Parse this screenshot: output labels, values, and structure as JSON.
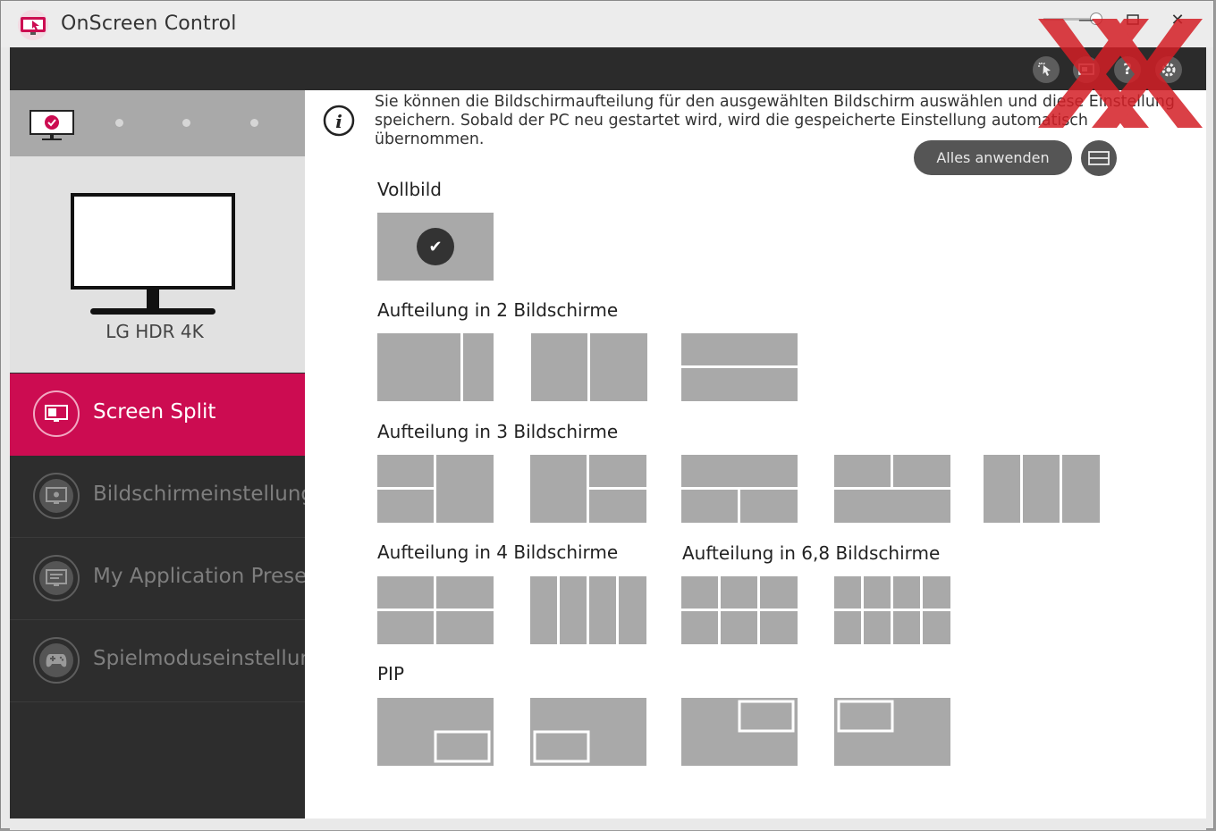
{
  "window": {
    "title": "OnScreen Control",
    "controls": {
      "minimize": "—",
      "maximize": "",
      "close": "✕"
    }
  },
  "toolbar": {
    "icons": [
      "pointer-icon",
      "monitor-toggle-icon",
      "help-icon",
      "settings-icon"
    ],
    "help_glyph": "?"
  },
  "sidebar": {
    "monitor_name": "LG HDR 4K",
    "menu": [
      {
        "label": "Screen Split",
        "icon": "screen-split-icon",
        "active": true
      },
      {
        "label": "Bildschirmeinstellungen",
        "icon": "brightness-icon",
        "active": false
      },
      {
        "label": "My Application Preset",
        "icon": "app-preset-icon",
        "active": false
      },
      {
        "label": "Spielmoduseinstellungen",
        "icon": "gamepad-icon",
        "active": false
      }
    ]
  },
  "content": {
    "info_text": "Sie können die Bildschirmaufteilung für den ausgewählten Bildschirm auswählen und diese Einstellung speichern. Sobald der PC neu gestartet wird, wird die gespeicherte Einstellung automatisch übernommen.",
    "apply_all": "Alles anwenden",
    "sections": {
      "full": "Vollbild",
      "split2": "Aufteilung in 2 Bildschirme",
      "split3": "Aufteilung in 3 Bildschirme",
      "split4": "Aufteilung in 4 Bildschirme",
      "split68": "Aufteilung in 6,8 Bildschirme",
      "pip": "PIP"
    },
    "selected_layout": "fullscreen"
  },
  "colors": {
    "accent": "#cc0c51",
    "tile": "#a9a9a9",
    "dark": "#2d2d2d"
  }
}
